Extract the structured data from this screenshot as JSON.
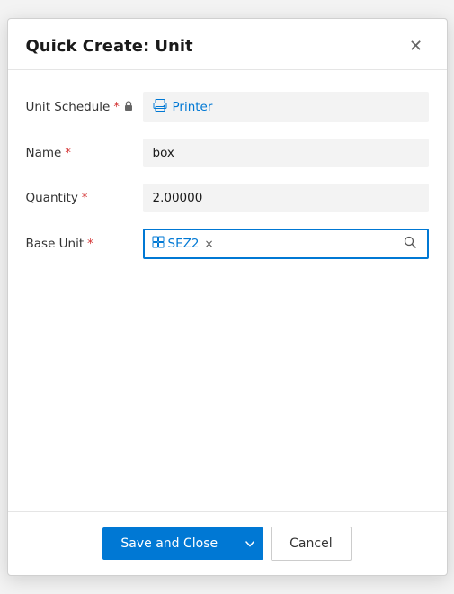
{
  "dialog": {
    "title": "Quick Create: Unit",
    "close_label": "×"
  },
  "form": {
    "unit_schedule": {
      "label": "Unit Schedule",
      "required": true,
      "locked": true,
      "value": "Printer",
      "link_text": "Printer"
    },
    "name": {
      "label": "Name",
      "required": true,
      "value": "box",
      "placeholder": ""
    },
    "quantity": {
      "label": "Quantity",
      "required": true,
      "value": "2.00000",
      "placeholder": ""
    },
    "base_unit": {
      "label": "Base Unit",
      "required": true,
      "tag_text": "SEZ2",
      "search_placeholder": "Search"
    }
  },
  "footer": {
    "save_close_label": "Save and Close",
    "cancel_label": "Cancel"
  },
  "icons": {
    "close": "✕",
    "lock": "🔒",
    "printer": "🖨",
    "entity": "⊞",
    "search": "🔍",
    "chevron_down": "▾",
    "remove": "×"
  }
}
